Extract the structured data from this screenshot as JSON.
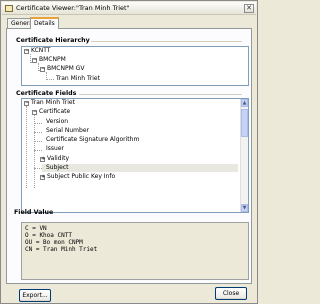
{
  "window": {
    "title": "Certificate Viewer:\"Tran Minh Triet\"",
    "close_glyph": "✕"
  },
  "tabs": [
    {
      "label": "General",
      "active": false
    },
    {
      "label": "Details",
      "active": true
    }
  ],
  "hierarchy": {
    "label": "Certificate Hierarchy",
    "items": [
      "KCNTT",
      "BMCNPM",
      "BMCNPM GV",
      "Tran Minh Triet"
    ]
  },
  "fields": {
    "label": "Certificate Fields",
    "items": [
      "Tran Minh Triet",
      "Certificate",
      "Version",
      "Serial Number",
      "Certificate Signature Algorithm",
      "Issuer",
      "Validity",
      "Subject",
      "Subject Public Key Info"
    ]
  },
  "field_value": {
    "label": "Field Value",
    "lines": [
      "C = VN",
      "O = Khoa CNTT",
      "OU = Bo mon CNPM",
      "CN = Tran Minh Triet"
    ]
  },
  "buttons": {
    "export": "Export...",
    "close": "Close"
  },
  "icons": {
    "expand": "+",
    "collapse": "−",
    "scroll_up": "▲",
    "scroll_down": "▼"
  }
}
